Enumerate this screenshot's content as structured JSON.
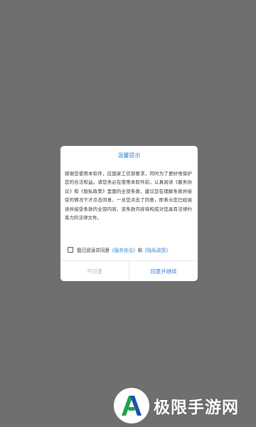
{
  "dialog": {
    "title": "温馨提示",
    "body": "感谢您使用本软件，应国家工信部要求，同时为了更好地保护您的合法权益。请您务必在使用本软件前，认真阅读《服务协议》和《隐私政策》里面的全部条款，建议您在理解条款并接受的情况下才点击同意，一旦您点击了同意，即表示您已经阅读并接受条款的全部内容，该条款内容将构成对您具有法律约束力的法律文件。",
    "agree_prefix": "我已阅读并同意",
    "service_link": "《服务协议》",
    "and_text": "和",
    "privacy_link": "《隐私政策》",
    "disagree_label": "不同意",
    "agree_label": "同意并继续"
  },
  "watermark": {
    "text": "极限手游网",
    "logo_icon": "n-shaped-logo-icon"
  },
  "colors": {
    "overlay": "#6f6f6f",
    "accent": "#3a86d6",
    "disabled": "#b9b9b9"
  }
}
